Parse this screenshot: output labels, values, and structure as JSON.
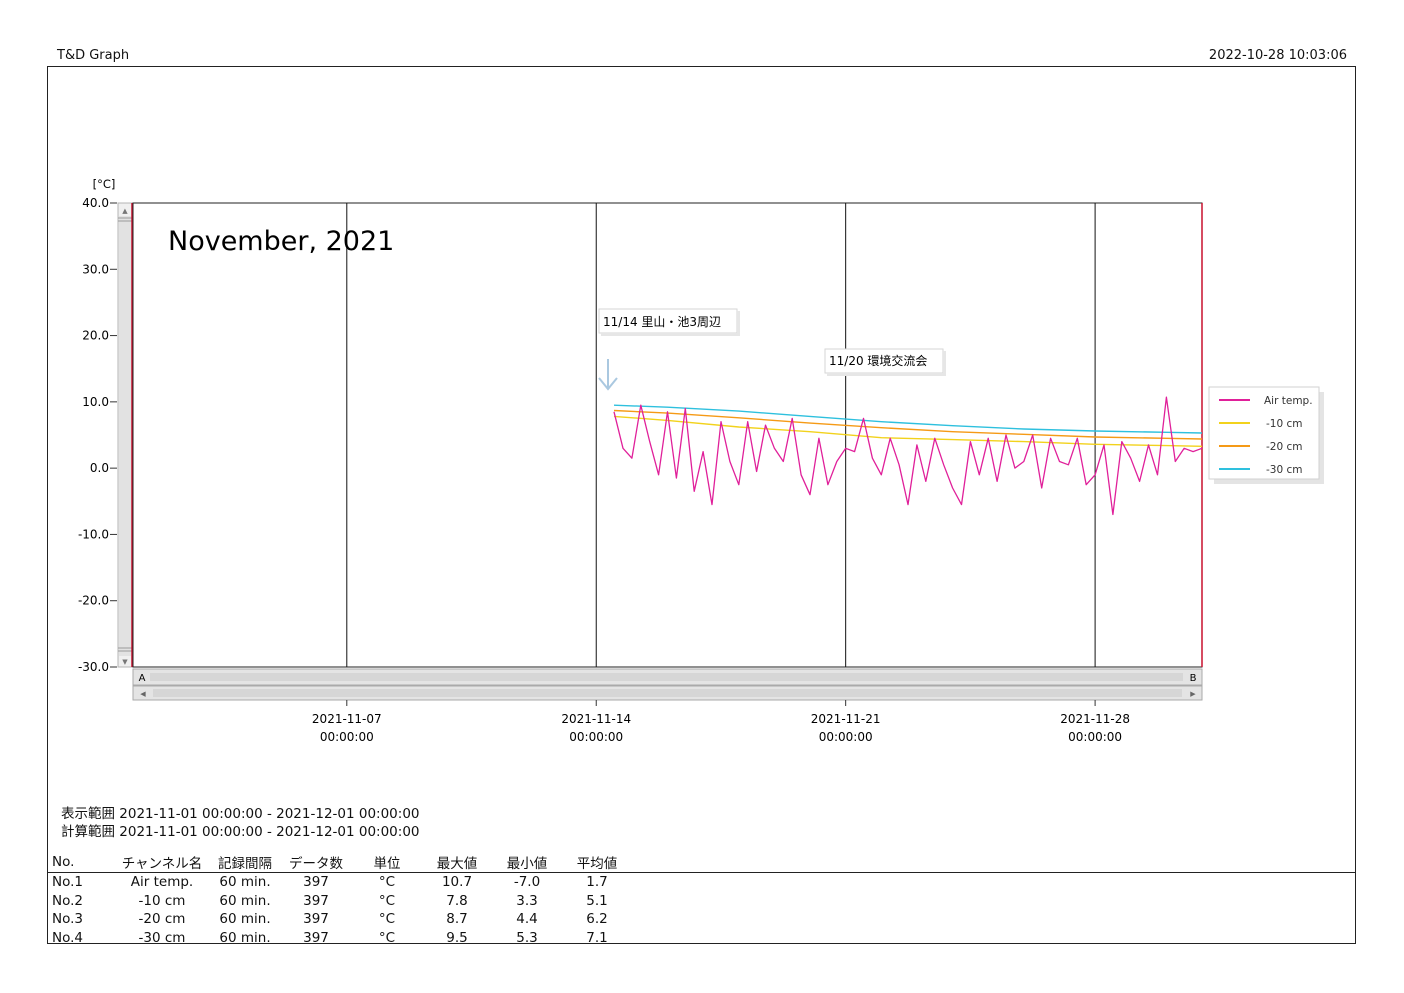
{
  "header": {
    "app_title": "T&D Graph",
    "print_time": "2022-10-28 10:03:06"
  },
  "colors": {
    "air": "#e0209a",
    "m10": "#f2d21c",
    "m20": "#f59a16",
    "m30": "#2ec0de",
    "gridline": "#111111",
    "plot_border_right": "#c8102e"
  },
  "chart_data": {
    "type": "line",
    "title": "November, 2021",
    "ylabel": "[°C]",
    "ylim": [
      -30,
      40
    ],
    "yticks": [
      "40.0",
      "30.0",
      "20.0",
      "10.0",
      "0.0",
      "-10.0",
      "-20.0",
      "-30.0"
    ],
    "xlim": [
      "2021-11-01 00:00",
      "2021-12-01 00:00"
    ],
    "xticks": [
      {
        "date": "2021-11-07",
        "time": "00:00:00"
      },
      {
        "date": "2021-11-14",
        "time": "00:00:00"
      },
      {
        "date": "2021-11-21",
        "time": "00:00:00"
      },
      {
        "date": "2021-11-28",
        "time": "00:00:00"
      }
    ],
    "scroll_markers": {
      "left": "A",
      "right": "B"
    },
    "legend": "right",
    "annotations": [
      {
        "text": "11/14 里山・池3周辺",
        "x": "2021-11-14 06:00"
      },
      {
        "text": "11/20 環境交流会",
        "x": "2021-11-20"
      }
    ],
    "series": [
      {
        "name": "Air temp.",
        "color_key": "air",
        "x": [
          "2021-11-14 12:00",
          "2021-11-14 18:00",
          "2021-11-15 00:00",
          "2021-11-15 06:00",
          "2021-11-15 12:00",
          "2021-11-15 18:00",
          "2021-11-16 00:00",
          "2021-11-16 06:00",
          "2021-11-16 12:00",
          "2021-11-16 18:00",
          "2021-11-17 00:00",
          "2021-11-17 06:00",
          "2021-11-17 12:00",
          "2021-11-17 18:00",
          "2021-11-18 00:00",
          "2021-11-18 06:00",
          "2021-11-18 12:00",
          "2021-11-18 18:00",
          "2021-11-19 00:00",
          "2021-11-19 06:00",
          "2021-11-19 12:00",
          "2021-11-19 18:00",
          "2021-11-20 00:00",
          "2021-11-20 06:00",
          "2021-11-20 12:00",
          "2021-11-20 18:00",
          "2021-11-21 00:00",
          "2021-11-21 06:00",
          "2021-11-21 12:00",
          "2021-11-21 18:00",
          "2021-11-22 00:00",
          "2021-11-22 06:00",
          "2021-11-22 12:00",
          "2021-11-22 18:00",
          "2021-11-23 00:00",
          "2021-11-23 06:00",
          "2021-11-23 12:00",
          "2021-11-23 18:00",
          "2021-11-24 00:00",
          "2021-11-24 06:00",
          "2021-11-24 12:00",
          "2021-11-24 18:00",
          "2021-11-25 00:00",
          "2021-11-25 06:00",
          "2021-11-25 12:00",
          "2021-11-25 18:00",
          "2021-11-26 00:00",
          "2021-11-26 06:00",
          "2021-11-26 12:00",
          "2021-11-26 18:00",
          "2021-11-27 00:00",
          "2021-11-27 06:00",
          "2021-11-27 12:00",
          "2021-11-27 18:00",
          "2021-11-28 00:00",
          "2021-11-28 06:00",
          "2021-11-28 12:00",
          "2021-11-28 18:00",
          "2021-11-29 00:00",
          "2021-11-29 06:00",
          "2021-11-29 12:00",
          "2021-11-29 18:00",
          "2021-11-30 00:00",
          "2021-11-30 06:00",
          "2021-11-30 12:00",
          "2021-11-30 18:00",
          "2021-12-01 00:00"
        ],
        "y": [
          8.5,
          3.0,
          1.5,
          9.5,
          4.0,
          -1.0,
          8.5,
          -1.5,
          9.0,
          -3.5,
          2.5,
          -5.5,
          7.0,
          1.0,
          -2.5,
          7.0,
          -0.5,
          6.5,
          3.0,
          1.0,
          7.5,
          -1.0,
          -4.0,
          4.5,
          -2.5,
          1.0,
          3.0,
          2.5,
          7.5,
          1.5,
          -1.0,
          4.5,
          0.5,
          -5.5,
          3.5,
          -2.0,
          4.5,
          0.5,
          -3.0,
          -5.5,
          4.0,
          -1.0,
          4.5,
          -2.0,
          5.0,
          0.0,
          1.0,
          5.0,
          -3.0,
          4.5,
          1.0,
          0.5,
          4.5,
          -2.5,
          -1.0,
          3.5,
          -7.0,
          4.0,
          1.5,
          -2.0,
          3.5,
          -1.0,
          10.7,
          1.0,
          3.0,
          2.5,
          3.0
        ]
      },
      {
        "name": "-10 cm",
        "color_key": "m10",
        "x": [
          "2021-11-14 12:00",
          "2021-11-16 00:00",
          "2021-11-18 00:00",
          "2021-11-20 00:00",
          "2021-11-22 00:00",
          "2021-11-24 00:00",
          "2021-11-26 00:00",
          "2021-11-28 00:00",
          "2021-11-30 00:00",
          "2021-12-01 00:00"
        ],
        "y": [
          7.8,
          7.2,
          6.2,
          5.5,
          4.6,
          4.3,
          4.0,
          3.6,
          3.4,
          3.3
        ]
      },
      {
        "name": "-20 cm",
        "color_key": "m20",
        "x": [
          "2021-11-14 12:00",
          "2021-11-16 00:00",
          "2021-11-18 00:00",
          "2021-11-20 00:00",
          "2021-11-22 00:00",
          "2021-11-24 00:00",
          "2021-11-26 00:00",
          "2021-11-28 00:00",
          "2021-11-30 00:00",
          "2021-12-01 00:00"
        ],
        "y": [
          8.7,
          8.3,
          7.6,
          6.8,
          6.1,
          5.5,
          5.1,
          4.7,
          4.5,
          4.4
        ]
      },
      {
        "name": "-30 cm",
        "color_key": "m30",
        "x": [
          "2021-11-14 12:00",
          "2021-11-16 00:00",
          "2021-11-18 00:00",
          "2021-11-20 00:00",
          "2021-11-22 00:00",
          "2021-11-24 00:00",
          "2021-11-26 00:00",
          "2021-11-28 00:00",
          "2021-11-30 00:00",
          "2021-12-01 00:00"
        ],
        "y": [
          9.5,
          9.2,
          8.6,
          7.8,
          7.0,
          6.4,
          5.9,
          5.6,
          5.4,
          5.3
        ]
      }
    ]
  },
  "footer": {
    "display_range": "表示範囲 2021-11-01 00:00:00 - 2021-12-01 00:00:00",
    "calc_range": "計算範囲 2021-11-01 00:00:00 - 2021-12-01 00:00:00"
  },
  "stats_table": {
    "headers": [
      "No.",
      "チャンネル名",
      "記録間隔",
      "データ数",
      "単位",
      "最大値",
      "最小値",
      "平均値"
    ],
    "rows": [
      [
        "No.1",
        "Air temp.",
        "60 min.",
        "397",
        "°C",
        "10.7",
        "-7.0",
        "1.7"
      ],
      [
        "No.2",
        "-10 cm",
        "60 min.",
        "397",
        "°C",
        "7.8",
        "3.3",
        "5.1"
      ],
      [
        "No.3",
        "-20 cm",
        "60 min.",
        "397",
        "°C",
        "8.7",
        "4.4",
        "6.2"
      ],
      [
        "No.4",
        "-30 cm",
        "60 min.",
        "397",
        "°C",
        "9.5",
        "5.3",
        "7.1"
      ]
    ]
  }
}
